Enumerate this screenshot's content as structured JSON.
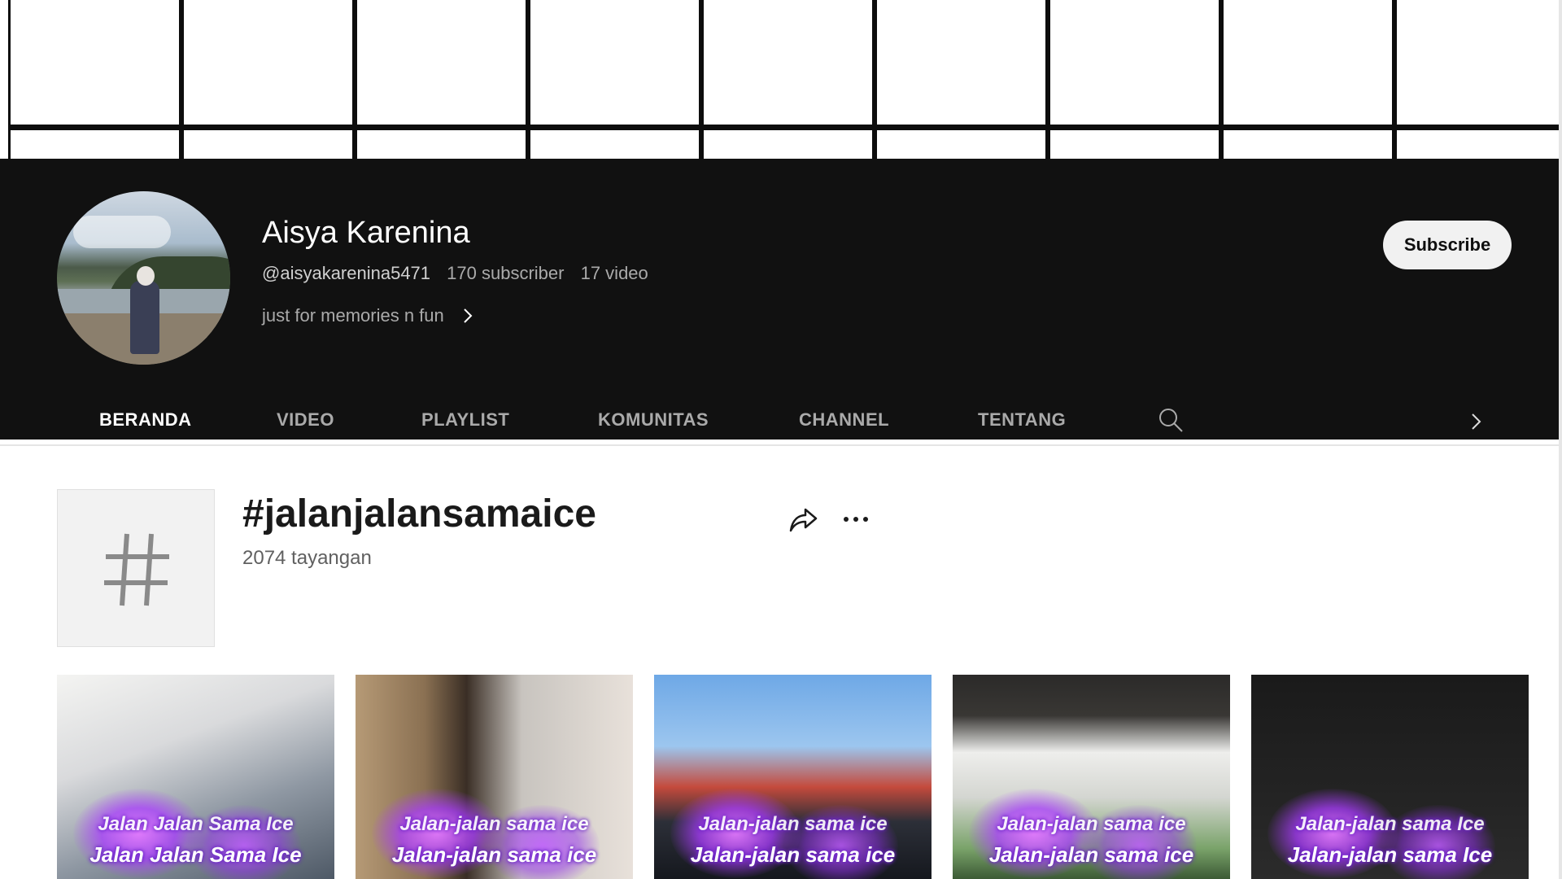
{
  "channel": {
    "name": "Aisya Karenina",
    "handle": "@aisyakarenina5471",
    "subscribers": "170 subscriber",
    "videos": "17 video",
    "description": "just for memories n fun",
    "subscribe_label": "Subscribe"
  },
  "tabs": [
    {
      "label": "BERANDA",
      "active": true
    },
    {
      "label": "VIDEO",
      "active": false
    },
    {
      "label": "PLAYLIST",
      "active": false
    },
    {
      "label": "KOMUNITAS",
      "active": false
    },
    {
      "label": "CHANNEL",
      "active": false
    },
    {
      "label": "TENTANG",
      "active": false
    }
  ],
  "hashtag": {
    "title": "#jalanjalansamaice",
    "views": "2074 tayangan"
  },
  "thumbnails": [
    {
      "caption_top": "Jalan Jalan Sama Ice",
      "caption_bottom": "Jalan Jalan Sama Ice"
    },
    {
      "caption_top": "Jalan-jalan sama ice",
      "caption_bottom": "Jalan-jalan sama ice"
    },
    {
      "caption_top": "Jalan-jalan sama ice",
      "caption_bottom": "Jalan-jalan sama ice"
    },
    {
      "caption_top": "Jalan-jalan sama ice",
      "caption_bottom": "Jalan-jalan sama ice"
    },
    {
      "caption_top": "Jalan-jalan sama Ice",
      "caption_bottom": "Jalan-jalan sama Ice"
    }
  ],
  "icons": {
    "search": "search-icon",
    "chevron": "chevron-right-icon",
    "share": "share-icon",
    "more": "more-horizontal-icon",
    "hashtag": "hashtag-icon"
  },
  "colors": {
    "header_bg": "#111111",
    "tab_active": "#ffffff",
    "tab_inactive": "#aaaaaa",
    "subscribe_bg": "#f1f1f1",
    "accent_glow": "#a93cff"
  }
}
